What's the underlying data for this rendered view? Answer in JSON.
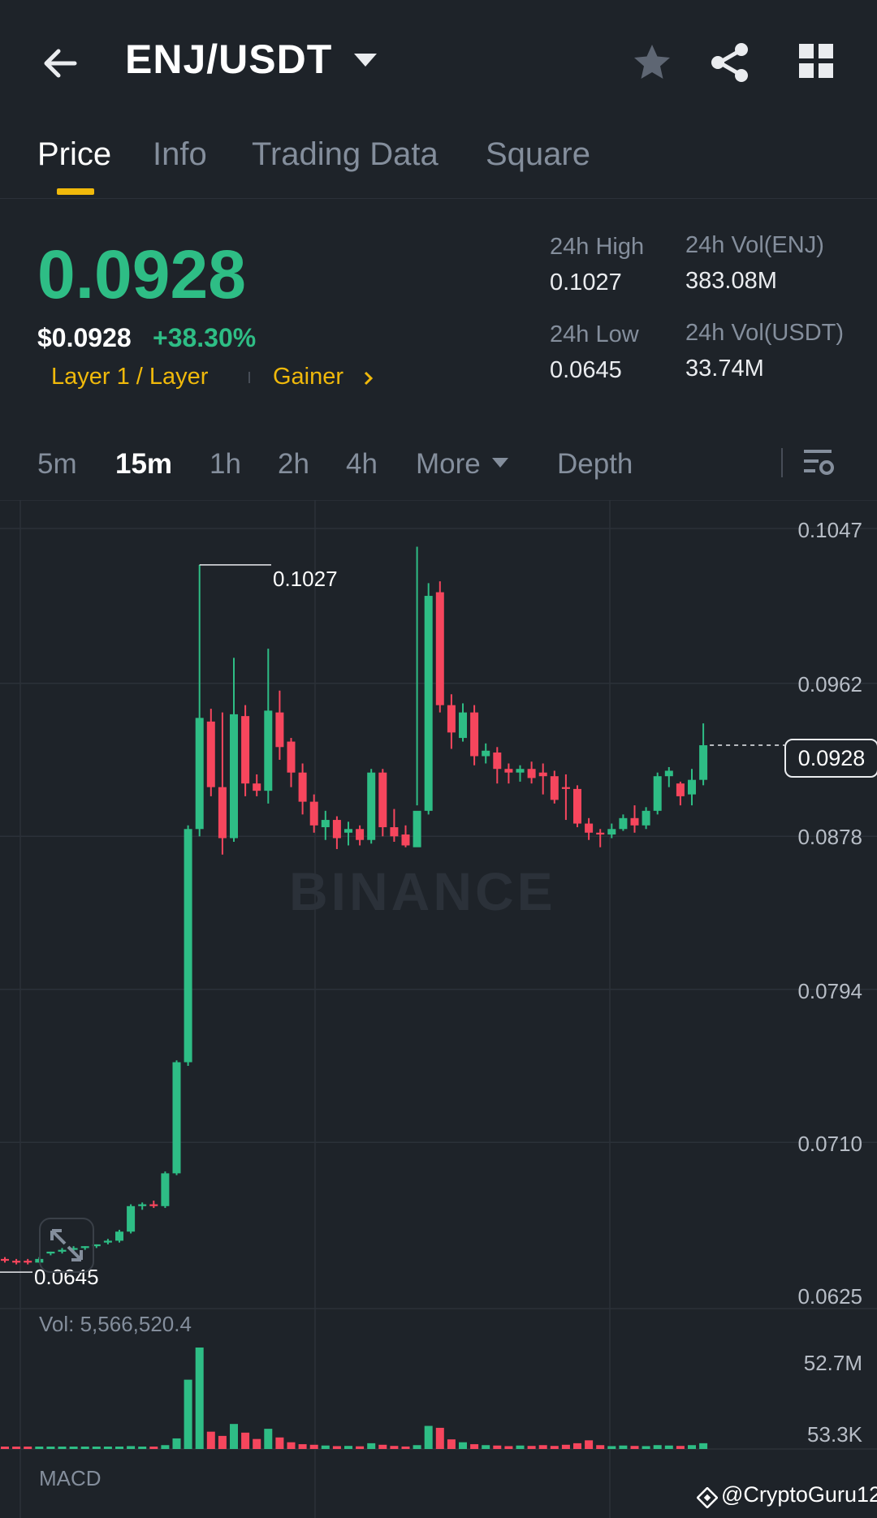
{
  "header": {
    "pair": "ENJ/USDT"
  },
  "tabs": [
    {
      "label": "Price",
      "active": true
    },
    {
      "label": "Info",
      "active": false
    },
    {
      "label": "Trading Data",
      "active": false
    },
    {
      "label": "Square",
      "active": false
    }
  ],
  "ticker": {
    "last_price": "0.0928",
    "usd_price": "$0.0928",
    "change_pct": "+38.30%",
    "tag_category": "Layer 1 / Layer",
    "tag_gainer": "Gainer",
    "high_label": "24h High",
    "high_value": "0.1027",
    "low_label": "24h Low",
    "low_value": "0.0645",
    "vol_base_label": "24h Vol(ENJ)",
    "vol_base_value": "383.08M",
    "vol_quote_label": "24h Vol(USDT)",
    "vol_quote_value": "33.74M"
  },
  "intervals": [
    {
      "label": "5m",
      "active": false
    },
    {
      "label": "15m",
      "active": true
    },
    {
      "label": "1h",
      "active": false
    },
    {
      "label": "2h",
      "active": false
    },
    {
      "label": "4h",
      "active": false
    },
    {
      "label": "More",
      "active": false
    },
    {
      "label": "Depth",
      "active": false
    }
  ],
  "chart": {
    "price_axis": [
      "0.1047",
      "0.0962",
      "0.0878",
      "0.0794",
      "0.0710",
      "0.0625"
    ],
    "current_price": "0.0928",
    "high_marker": "0.1027",
    "low_marker": "0.0645",
    "watermark": "BINANCE",
    "vol_label": "Vol: 5,566,520.4",
    "vol_axis": [
      "52.7M",
      "53.3K"
    ],
    "macd_label": "MACD",
    "colors": {
      "up": "#2ebd85",
      "down": "#f6465d",
      "grid": "#2b3139"
    }
  },
  "chart_data": {
    "type": "candlestick",
    "interval": "15m",
    "ylim": [
      0.0625,
      0.1047
    ],
    "candles": [
      [
        0.0646,
        0.0647,
        0.0644,
        0.0645
      ],
      [
        0.0645,
        0.0646,
        0.0643,
        0.0644
      ],
      [
        0.0645,
        0.0646,
        0.0643,
        0.0644
      ],
      [
        0.0644,
        0.0647,
        0.0644,
        0.0646
      ],
      [
        0.0649,
        0.065,
        0.0648,
        0.065
      ],
      [
        0.065,
        0.0652,
        0.0649,
        0.0651
      ],
      [
        0.0651,
        0.0653,
        0.065,
        0.0652
      ],
      [
        0.0652,
        0.0653,
        0.0651,
        0.0653
      ],
      [
        0.0653,
        0.0654,
        0.0652,
        0.0654
      ],
      [
        0.0655,
        0.0657,
        0.0654,
        0.0656
      ],
      [
        0.0656,
        0.0662,
        0.0655,
        0.0661
      ],
      [
        0.0661,
        0.0676,
        0.066,
        0.0675
      ],
      [
        0.0675,
        0.0677,
        0.0673,
        0.0676
      ],
      [
        0.0676,
        0.0678,
        0.0674,
        0.0675
      ],
      [
        0.0675,
        0.0694,
        0.0674,
        0.0693
      ],
      [
        0.0693,
        0.0755,
        0.0692,
        0.0754
      ],
      [
        0.0754,
        0.0884,
        0.0752,
        0.0882
      ],
      [
        0.0882,
        0.1027,
        0.0878,
        0.0943
      ],
      [
        0.0941,
        0.0948,
        0.09,
        0.0905
      ],
      [
        0.0905,
        0.0946,
        0.0868,
        0.0877
      ],
      [
        0.0877,
        0.0976,
        0.0875,
        0.0945
      ],
      [
        0.0944,
        0.095,
        0.09,
        0.0907
      ],
      [
        0.0907,
        0.0912,
        0.09,
        0.0903
      ],
      [
        0.0903,
        0.0981,
        0.0896,
        0.0947
      ],
      [
        0.0946,
        0.0958,
        0.092,
        0.0927
      ],
      [
        0.093,
        0.0932,
        0.0905,
        0.0913
      ],
      [
        0.0913,
        0.0918,
        0.089,
        0.0897
      ],
      [
        0.0897,
        0.0901,
        0.088,
        0.0884
      ],
      [
        0.0883,
        0.0892,
        0.0876,
        0.0887
      ],
      [
        0.0887,
        0.0889,
        0.0871,
        0.0877
      ],
      [
        0.088,
        0.0886,
        0.0873,
        0.0882
      ],
      [
        0.0882,
        0.0884,
        0.0873,
        0.0876
      ],
      [
        0.0876,
        0.0915,
        0.0874,
        0.0913
      ],
      [
        0.0913,
        0.0915,
        0.0878,
        0.0883
      ],
      [
        0.0883,
        0.0893,
        0.0875,
        0.0878
      ],
      [
        0.0879,
        0.0884,
        0.0872,
        0.0873
      ],
      [
        0.0872,
        0.0895,
        0.1037,
        0.0892
      ],
      [
        0.0892,
        0.1017,
        0.089,
        0.101
      ],
      [
        0.1012,
        0.1018,
        0.0946,
        0.095
      ],
      [
        0.095,
        0.0956,
        0.0926,
        0.0935
      ],
      [
        0.0932,
        0.0951,
        0.093,
        0.0946
      ],
      [
        0.0946,
        0.095,
        0.0917,
        0.0922
      ],
      [
        0.0922,
        0.0929,
        0.0918,
        0.0925
      ],
      [
        0.0924,
        0.0927,
        0.0907,
        0.0915
      ],
      [
        0.0915,
        0.0918,
        0.0907,
        0.0913
      ],
      [
        0.0913,
        0.0917,
        0.0908,
        0.0915
      ],
      [
        0.0915,
        0.0919,
        0.0907,
        0.091
      ],
      [
        0.0913,
        0.0918,
        0.0901,
        0.0911
      ],
      [
        0.0911,
        0.0914,
        0.0896,
        0.0898
      ],
      [
        0.0905,
        0.0912,
        0.0887,
        0.0904
      ],
      [
        0.0904,
        0.0906,
        0.0883,
        0.0885
      ],
      [
        0.0885,
        0.0888,
        0.0876,
        0.088
      ],
      [
        0.088,
        0.0882,
        0.0872,
        0.0879
      ],
      [
        0.0879,
        0.0885,
        0.0877,
        0.0882
      ],
      [
        0.0882,
        0.089,
        0.0881,
        0.0888
      ],
      [
        0.0888,
        0.0895,
        0.088,
        0.0884
      ],
      [
        0.0884,
        0.0894,
        0.0882,
        0.0892
      ],
      [
        0.0892,
        0.0913,
        0.089,
        0.0911
      ],
      [
        0.0911,
        0.0916,
        0.0905,
        0.0914
      ],
      [
        0.0907,
        0.0908,
        0.0895,
        0.09
      ],
      [
        0.0901,
        0.0915,
        0.0895,
        0.0909
      ],
      [
        0.0909,
        0.094,
        0.0906,
        0.0928
      ]
    ],
    "volumes": [
      0.8,
      0.6,
      0.5,
      0.5,
      0.6,
      0.5,
      0.5,
      0.6,
      0.5,
      0.7,
      0.9,
      1.5,
      1.2,
      0.9,
      2.0,
      5.5,
      36.0,
      52.7,
      9.0,
      6.8,
      13.0,
      8.5,
      5.2,
      10.5,
      6.0,
      3.5,
      2.5,
      2.2,
      1.8,
      1.5,
      1.6,
      1.4,
      3.0,
      2.2,
      1.6,
      1.3,
      2.0,
      12.0,
      11.0,
      5.0,
      3.5,
      2.5,
      2.0,
      1.8,
      1.5,
      1.8,
      1.6,
      2.0,
      1.6,
      2.2,
      3.0,
      4.5,
      2.0,
      1.5,
      1.8,
      1.6,
      1.5,
      2.0,
      1.8,
      1.6,
      2.0,
      3.0
    ]
  }
}
